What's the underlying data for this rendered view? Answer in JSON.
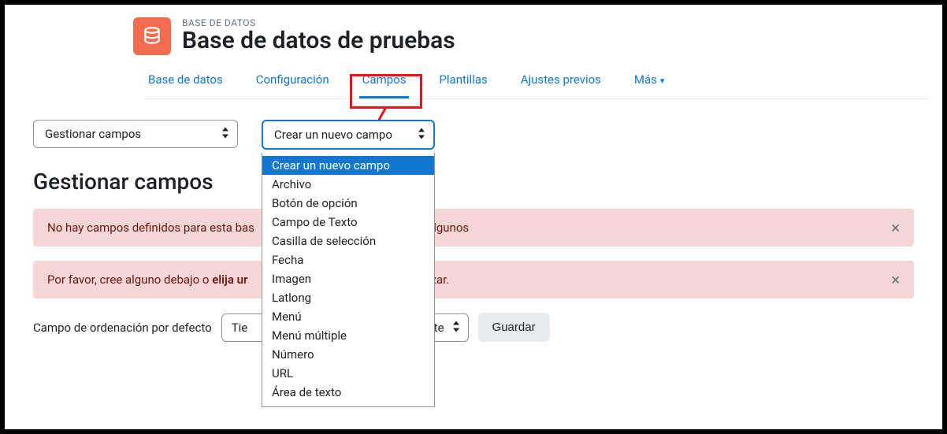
{
  "header": {
    "overline": "BASE DE DATOS",
    "title": "Base de datos de pruebas"
  },
  "tabs": {
    "items": [
      {
        "label": "Base de datos"
      },
      {
        "label": "Configuración"
      },
      {
        "label": "Campos"
      },
      {
        "label": "Plantillas"
      },
      {
        "label": "Ajustes previos"
      },
      {
        "label": "Más"
      }
    ],
    "active_index": 2
  },
  "controls": {
    "manage_fields_label": "Gestionar campos",
    "create_field_label": "Crear un nuevo campo",
    "create_field_options": [
      "Crear un nuevo campo",
      "Archivo",
      "Botón de opción",
      "Campo de Texto",
      "Casilla de selección",
      "Fecha",
      "Imagen",
      "Latlong",
      "Menú",
      "Menú múltiple",
      "Número",
      "URL",
      "Área de texto"
    ]
  },
  "section_title": "Gestionar campos",
  "alerts": {
    "no_fields_prefix": "No hay campos definidos para esta bas",
    "no_fields_suffix": "e algunos",
    "please_create_prefix": "Por favor, cree alguno debajo o ",
    "please_create_bold": "elija ur",
    "please_create_suffix": "npezar."
  },
  "sort": {
    "label": "Campo de ordenación por defecto",
    "field_value": "Tie",
    "direction_value": "ndente",
    "save_label": "Guardar"
  }
}
